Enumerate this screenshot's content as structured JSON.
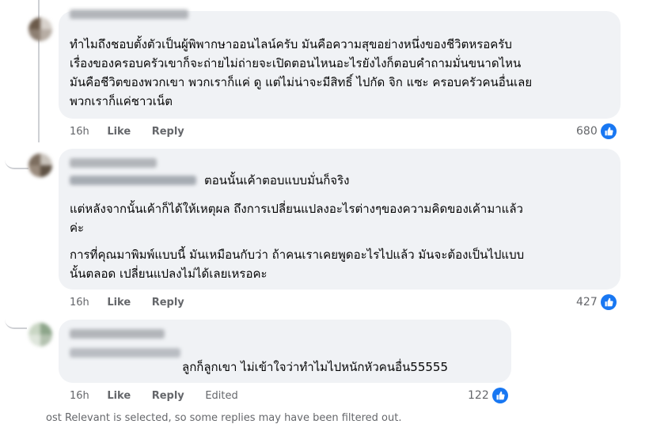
{
  "comments": [
    {
      "lines": [
        "ทำไมถึงชอบตั้งตัวเป็นผู้พิพากษาออนไลน์ครับ มันคือความสุขอย่างหนึ่งของชีวิตหรอครับ",
        "เรื่องของครอบครัวเขาก็จะถ่ายไม่ถ่ายจะเปิดตอนไหนอะไรยังไงก็ตอบคำถามมั่นขนาดไหน",
        "มันคือชีวิตของพวกเขา พวกเราก็แค่ ดู แต่ไม่น่าจะมีสิทธิ์ ไปกัด จิก แซะ ครอบครัวคนอื่นเลย",
        "พวกเราก็แค่ชาวเน็ต"
      ],
      "time": "16h",
      "like": "Like",
      "reply": "Reply",
      "reactions": "680"
    },
    {
      "mention_rest": "ตอนนั้นเค้าตอบแบบมั่นก็จริง",
      "para2": [
        "แต่หลังจากนั้นเค้าก็ได้ให้เหตุผล ถึงการเปลี่ยนแปลงอะไรต่างๆของความคิดของเค้ามาแล้ว",
        "ค่ะ"
      ],
      "para3": [
        "การที่คุณมาพิมพ์แบบนี้ มันเหมือนกับว่า ถ้าคนเราเคยพูดอะไรไปแล้ว มันจะต้องเป็นไปแบบ",
        "นั้นตลอด เปลี่ยนแปลงไม่ได้เลยเหรอคะ"
      ],
      "time": "16h",
      "like": "Like",
      "reply": "Reply",
      "reactions": "427"
    },
    {
      "mention_rest": "ลูกก็ลูกเขา ไม่เข้าใจว่าทำไมไปหนักหัวคนอื่น55555",
      "time": "16h",
      "like": "Like",
      "reply": "Reply",
      "edited": "Edited",
      "reactions": "122"
    }
  ],
  "footer_note": "ost Relevant is selected, so some replies may have been filtered out.",
  "colors": {
    "like_blue": "#1877f2",
    "bubble": "#f0f2f5",
    "meta": "#65676b"
  }
}
